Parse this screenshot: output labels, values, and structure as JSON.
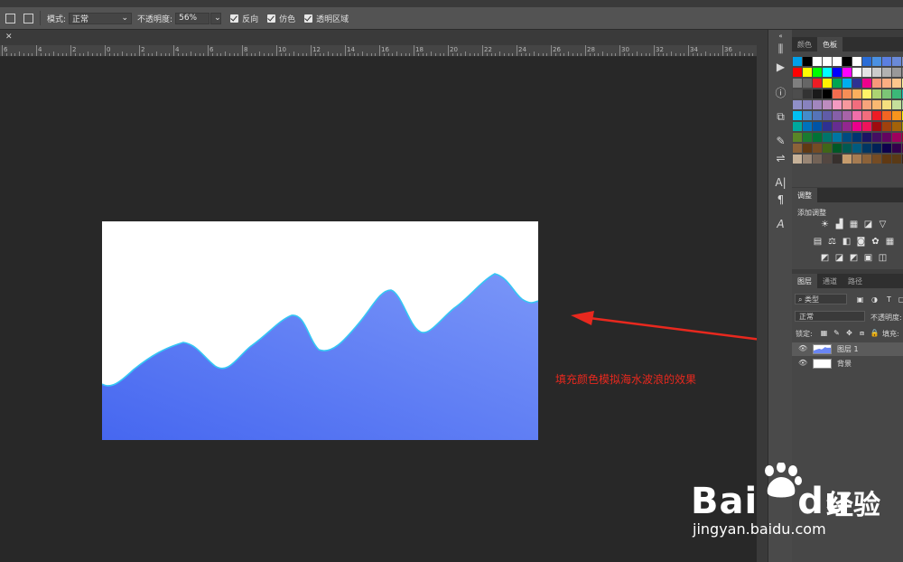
{
  "options_bar": {
    "mode_label": "模式:",
    "mode_value": "正常",
    "opacity_label": "不透明度:",
    "opacity_value": "56%",
    "reverse_label": "反向",
    "dither_label": "仿色",
    "transparency_label": "透明区域"
  },
  "ruler": {
    "labels": [
      "6",
      "4",
      "2",
      "0",
      "2",
      "4",
      "6",
      "8",
      "10",
      "12",
      "14",
      "16",
      "18",
      "20",
      "22",
      "24",
      "26",
      "28",
      "30",
      "32",
      "34",
      "36"
    ]
  },
  "annotation": {
    "text": "填充颜色模拟海水波浪的效果",
    "color": "#e8281e"
  },
  "canvas": {
    "background": "#ffffff",
    "wave_gradient": [
      "#4667f0",
      "#7a96f8"
    ],
    "wave_stroke": "#35c6f4"
  },
  "swatches_panel": {
    "tabs": [
      "颜色",
      "色板"
    ],
    "active_tab": "色板",
    "rows": [
      [
        "#00a0e9",
        "#000000",
        "#ffffff",
        "#ffffff",
        "#ffffff",
        "#000000",
        "#ffffff",
        "#2a6dd6",
        "#4a90e2",
        "#5b7fe0",
        "#6a8ad8",
        "#7d93d6"
      ],
      [
        "#ff0000",
        "#ffff00",
        "#00ff00",
        "#00ffff",
        "#0000ff",
        "#ff00ff",
        "#ffffff",
        "#e5e5e5",
        "#cccccc",
        "#b2b2b2",
        "#999999",
        "#808080"
      ],
      [
        "#7f7f7f",
        "#666666",
        "#ed1c24",
        "#fff200",
        "#00a651",
        "#00aeef",
        "#2e3192",
        "#ec008c",
        "#f7977a",
        "#fbad82",
        "#fdc68c",
        "#fff799"
      ],
      [
        "#4d4d4d",
        "#333333",
        "#1a1a1a",
        "#000000",
        "#f26c4f",
        "#f68e56",
        "#fbaf5d",
        "#fff467",
        "#acd372",
        "#7cc576",
        "#3bb878",
        "#1abbb4"
      ],
      [
        "#8f8fc7",
        "#8882be",
        "#a186be",
        "#bd8cbf",
        "#f49ac1",
        "#f6989d",
        "#f26d7d",
        "#f7a47b",
        "#f9b871",
        "#f4e07e",
        "#c4df9b",
        "#a3d39c"
      ],
      [
        "#00bff3",
        "#448ccb",
        "#5574b9",
        "#605ca8",
        "#855fa8",
        "#a763a8",
        "#f06eaa",
        "#f26d7d",
        "#ed1c24",
        "#f26522",
        "#f7941d",
        "#fff200"
      ],
      [
        "#00a99d",
        "#0072bc",
        "#0054a6",
        "#2e3192",
        "#662d91",
        "#92278f",
        "#ec008c",
        "#ed145b",
        "#9e0b0f",
        "#a0410d",
        "#a36209",
        "#aba000"
      ],
      [
        "#598527",
        "#1a7b30",
        "#007236",
        "#00746b",
        "#0076a3",
        "#004b80",
        "#003471",
        "#1b1464",
        "#440e62",
        "#630460",
        "#9e005d",
        "#9e0039"
      ],
      [
        "#8c6239",
        "#603913",
        "#754c24",
        "#406618",
        "#005826",
        "#005952",
        "#005b7f",
        "#003663",
        "#002157",
        "#0d004c",
        "#32004b",
        "#4b0049"
      ],
      [
        "#c7b299",
        "#998675",
        "#736357",
        "#534741",
        "#37302d",
        "#c69c6d",
        "#a67c52",
        "#8c6239",
        "#754c24",
        "#603913",
        "#5a3a16",
        "#3c2415"
      ]
    ]
  },
  "adjustments_panel": {
    "tab": "调整",
    "add_label": "添加调整"
  },
  "layers_panel": {
    "tabs": [
      "图层",
      "通道",
      "路径"
    ],
    "active_tab": "图层",
    "filter_label": "类型",
    "blend_mode": "正常",
    "opacity_label": "不透明度:",
    "lock_label": "锁定:",
    "fill_label": "填充:",
    "layers": [
      {
        "name": "图层 1",
        "selected": true
      },
      {
        "name": "背景",
        "selected": false
      }
    ]
  },
  "watermark": {
    "logo": "Bai",
    "logo_suffix": "du",
    "cn": "经验",
    "url": "jingyan.baidu.com"
  }
}
